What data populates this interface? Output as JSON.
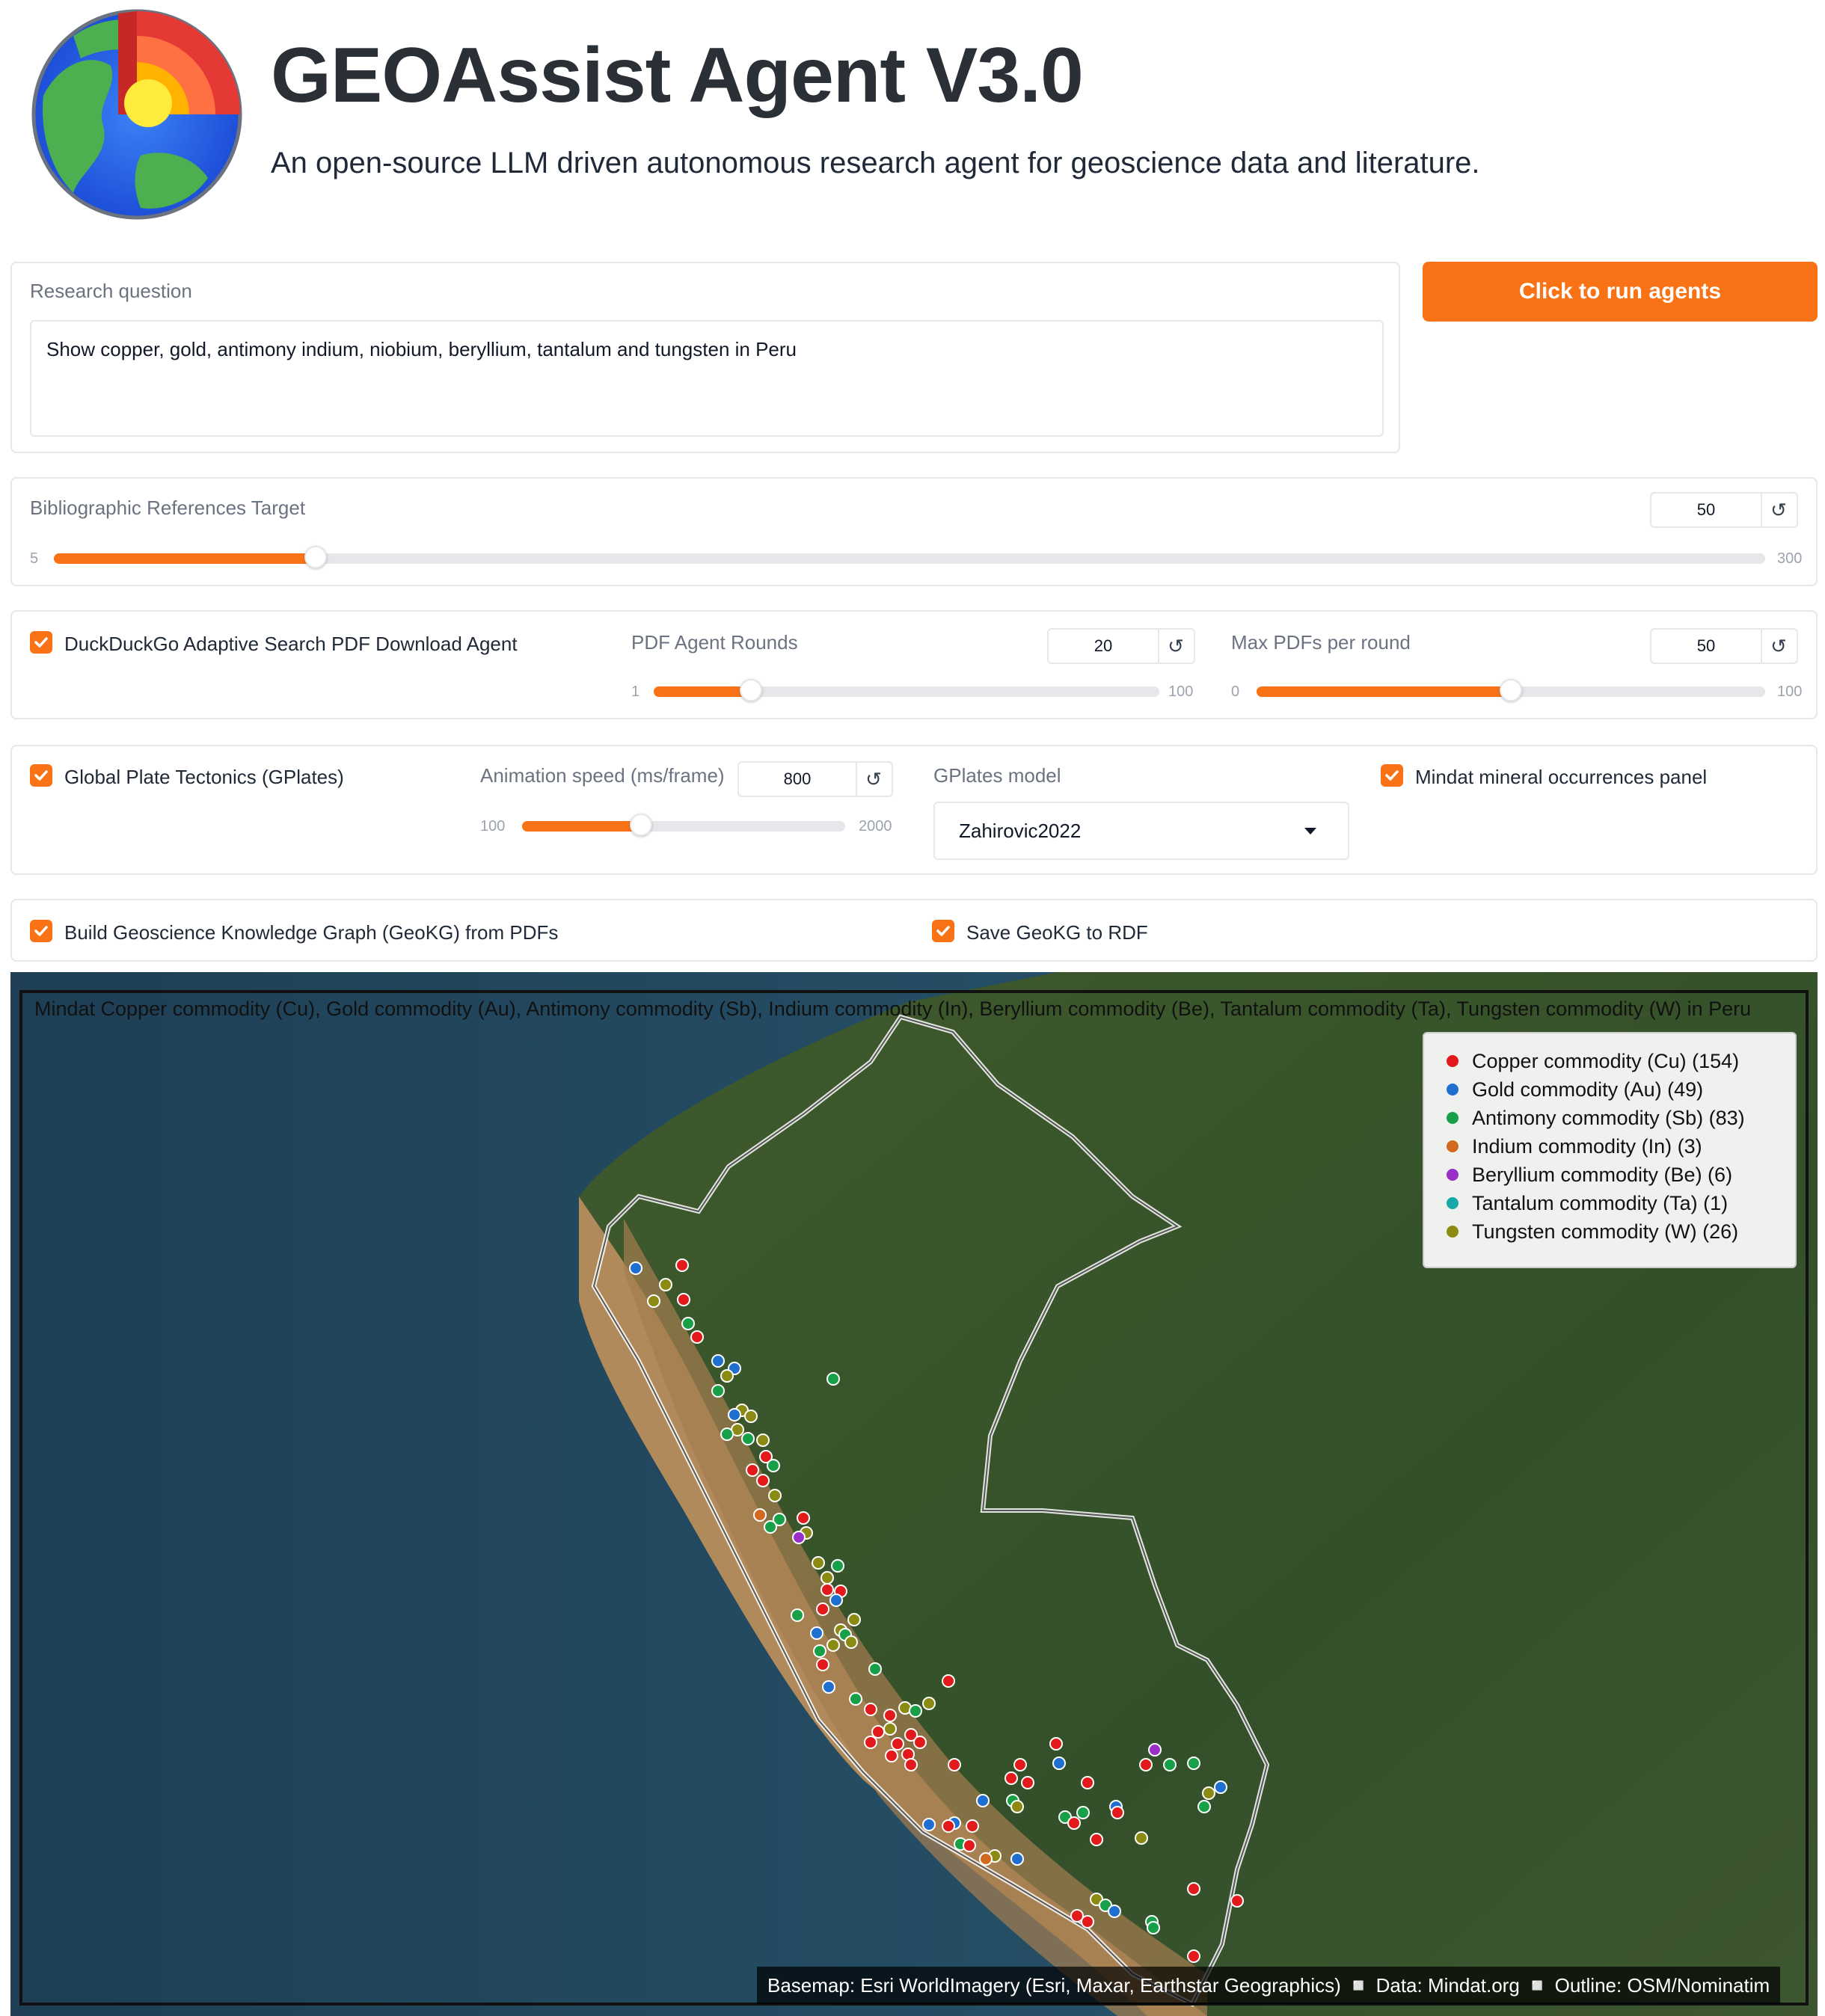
{
  "header": {
    "title": "GEOAssist Agent V3.0",
    "subtitle": "An open-source LLM driven autonomous research agent for geoscience data and literature."
  },
  "research": {
    "label": "Research question",
    "value": "Show copper, gold, antimony indium, niobium, beryllium, tantalum and tungsten in Peru"
  },
  "run_button": "Click to run agents",
  "biblio": {
    "label": "Bibliographic References Target",
    "value": "50",
    "min": "5",
    "max": "300",
    "fraction": 0.153
  },
  "ddg": {
    "checkbox_label": "DuckDuckGo Adaptive Search PDF Download Agent",
    "checked": true,
    "rounds": {
      "label": "PDF Agent Rounds",
      "value": "20",
      "min": "1",
      "max": "100",
      "fraction": 0.192
    },
    "max_pdfs": {
      "label": "Max PDFs per round",
      "value": "50",
      "min": "0",
      "max": "100",
      "fraction": 0.5
    }
  },
  "gplates": {
    "checkbox_label": "Global Plate Tectonics (GPlates)",
    "checked": true,
    "speed": {
      "label": "Animation speed (ms/frame)",
      "value": "800",
      "min": "100",
      "max": "2000",
      "fraction": 0.368
    },
    "model": {
      "label": "GPlates model",
      "value": "Zahirovic2022"
    },
    "mindat_label": "Mindat mineral occurrences panel",
    "mindat_checked": true
  },
  "geokg": {
    "build_label": "Build Geoscience Knowledge Graph (GeoKG) from PDFs",
    "save_label": "Save GeoKG to RDF"
  },
  "map": {
    "title": "Mindat Copper commodity (Cu), Gold commodity (Au), Antimony commodity (Sb), Indium commodity (In), Beryllium commodity (Be), Tantalum commodity (Ta), Tungsten commodity (W) in Peru",
    "legend": [
      {
        "label": "Copper commodity (Cu) (154)",
        "color": "#e31a1c"
      },
      {
        "label": "Gold commodity (Au) (49)",
        "color": "#1f6fd1"
      },
      {
        "label": "Antimony commodity (Sb) (83)",
        "color": "#18a049"
      },
      {
        "label": "Indium commodity (In) (3)",
        "color": "#d2691e"
      },
      {
        "label": "Beryllium commodity (Be) (6)",
        "color": "#9b30c8"
      },
      {
        "label": "Tantalum commodity (Ta) (1)",
        "color": "#17a8a8"
      },
      {
        "label": "Tungsten commodity (W) (26)",
        "color": "#8b8b14"
      }
    ],
    "attribution": "Basemap: Esri WorldImagery (Esri, Maxar, Earthstar Geographics) ◽ Data: Mindat.org ◽ Outline: OSM/Nominatim"
  },
  "icons": {
    "logo": "globe-core-icon",
    "reset": "reset-icon",
    "checkbox": "check-icon",
    "dropdown": "chevron-down-icon"
  },
  "colors": {
    "accent": "#f97316",
    "border": "#e5e7eb"
  }
}
